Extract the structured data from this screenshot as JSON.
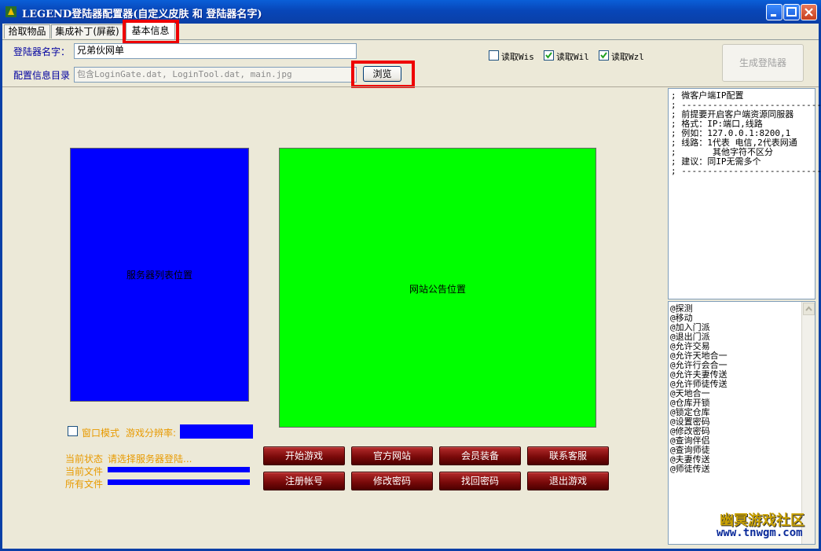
{
  "window": {
    "title": "LEGEND登陆器配置器(自定义皮肤 和 登陆器名字)"
  },
  "tabs": [
    {
      "label": "拾取物品"
    },
    {
      "label": "集成补丁(屏蔽)"
    },
    {
      "label": "基本信息"
    }
  ],
  "form": {
    "name_label": "登陆器名字：",
    "name_value": "兄弟伙网单",
    "config_label": "配置信息目录",
    "config_placeholder": "包含LoginGate.dat, LoginTool.dat, main.jpg",
    "browse_label": "浏览",
    "generate_label": "生成登陆器"
  },
  "checkboxes": [
    {
      "label": "读取Wis",
      "checked": false
    },
    {
      "label": "读取Wil",
      "checked": true
    },
    {
      "label": "读取Wzl",
      "checked": true
    }
  ],
  "preview": {
    "server_list_label": "服务器列表位置",
    "server_list_color": "#0000FF",
    "notice_label": "网站公告位置",
    "notice_color": "#00FF00",
    "window_mode_label": "窗口模式",
    "resolution_label": "游戏分辨率:",
    "status_label": "当前状态",
    "status_text": "请选择服务器登陆...",
    "current_file_label": "当前文件",
    "all_files_label": "所有文件"
  },
  "game_buttons": [
    {
      "label": "开始游戏"
    },
    {
      "label": "官方网站"
    },
    {
      "label": "会员装备"
    },
    {
      "label": "联系客服"
    },
    {
      "label": "注册帐号"
    },
    {
      "label": "修改密码"
    },
    {
      "label": "找回密码"
    },
    {
      "label": "退出游戏"
    }
  ],
  "ip_config": {
    "lines": [
      "; 微客户端IP配置",
      "; ----------------------------",
      "; 前提要开启客户端资源同服器",
      "; 格式：IP:端口,线路",
      "; 例如：127.0.0.1:8200,1",
      "; 线路：1代表 电信,2代表网通",
      ";       其他字符不区分",
      "; 建议：同IP无需多个",
      "; ----------------------------"
    ]
  },
  "commands": {
    "lines": [
      "@探测",
      "@移动",
      "@加入门派",
      "@退出门派",
      "@允许交易",
      "@允许天地合一",
      "@允许行会合一",
      "@允许夫妻传送",
      "@允许师徒传送",
      "@天地合一",
      "@仓库开锁",
      "@锁定仓库",
      "@设置密码",
      "@修改密码",
      "@查询伴侣",
      "@查询师徒",
      "@夫妻传送",
      "@师徒传送"
    ]
  },
  "watermark": {
    "title": "幽冥游戏社区",
    "url": "www.tnwgm.com"
  },
  "colors": {
    "titlebar": "#0A50C8",
    "highlight_box": "#EE0000",
    "orange_text": "#E89A00",
    "label_blue": "#0000A0"
  }
}
